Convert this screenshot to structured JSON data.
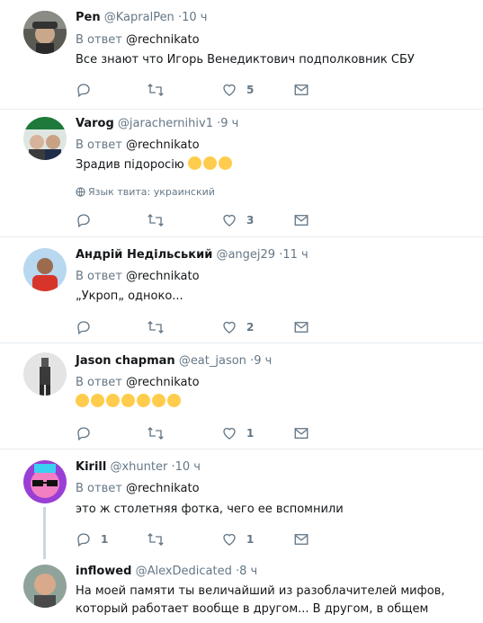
{
  "tweets": [
    {
      "name": "Pen",
      "handle": "@KapralPen",
      "time": "·10 ч",
      "reply_prefix": "В ответ",
      "reply_mention": "@rechnikato",
      "text": "Все знают что Игорь Венедиктович подполковник СБУ",
      "reply_count": "",
      "retweet_count": "",
      "like_count": "5"
    },
    {
      "name": "Varog",
      "handle": "@jarachernihiv1",
      "time": "·9 ч",
      "reply_prefix": "В ответ",
      "reply_mention": "@rechnikato",
      "text": "Зрадив підоросію",
      "emoji": [
        "grinning-emoji",
        "grinning-emoji",
        "grinning-emoji"
      ],
      "language": "Язык твита: украинский",
      "reply_count": "",
      "retweet_count": "",
      "like_count": "3"
    },
    {
      "name": "Андрій Недільський",
      "handle": "@angej29",
      "time": "·11 ч",
      "reply_prefix": "В ответ",
      "reply_mention": "@rechnikato",
      "text": "„Укроп„ одноко...",
      "reply_count": "",
      "retweet_count": "",
      "like_count": "2"
    },
    {
      "name": "Jason chapman",
      "handle": "@eat_jason",
      "time": "·9 ч",
      "reply_prefix": "В ответ",
      "reply_mention": "@rechnikato",
      "text": "",
      "emoji": [
        "tears-of-joy-emoji",
        "tears-of-joy-emoji",
        "tears-of-joy-emoji",
        "tears-of-joy-emoji",
        "tears-of-joy-emoji",
        "tears-of-joy-emoji",
        "tears-of-joy-emoji"
      ],
      "reply_count": "",
      "retweet_count": "",
      "like_count": "1"
    },
    {
      "name": "Kirill",
      "handle": "@xhunter",
      "time": "·10 ч",
      "reply_prefix": "В ответ",
      "reply_mention": "@rechnikato",
      "text": "это ж столетняя фотка, чего ее вспомнили",
      "reply_count": "1",
      "retweet_count": "",
      "like_count": "1"
    },
    {
      "name": "inflowed",
      "handle": "@AlexDedicated",
      "time": "·8 ч",
      "text": "На моей памяти ты величайший из разоблачителей мифов, который работает вообще в другом... В другом, в общем"
    }
  ],
  "colors": {
    "text": "#14171a",
    "secondary": "#657786",
    "divider": "#e6ecf0",
    "thread_line": "#ccd6dd",
    "emoji_yellow": "#ffcc4d"
  },
  "icons": {
    "reply": "reply-icon",
    "retweet": "retweet-icon",
    "like": "heart-icon",
    "dm": "envelope-icon",
    "language": "globe-icon"
  }
}
